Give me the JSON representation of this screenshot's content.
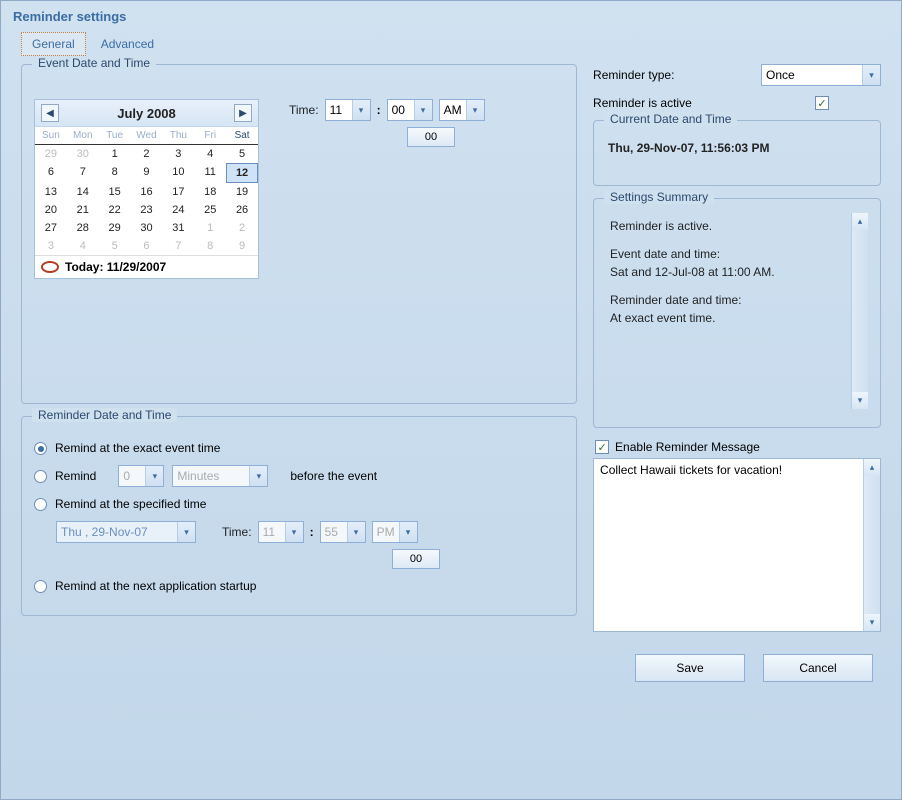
{
  "title": "Reminder settings",
  "tabs": {
    "general": "General",
    "advanced": "Advanced"
  },
  "event": {
    "legend": "Event Date and Time",
    "calendar": {
      "title": "July 2008",
      "day_heads": [
        "Sun",
        "Mon",
        "Tue",
        "Wed",
        "Thu",
        "Fri",
        "Sat"
      ],
      "today_label": "Today: 11/29/2007",
      "selected_day": 12
    },
    "time": {
      "label": "Time:",
      "hour": "11",
      "minute": "00",
      "ampm": "AM",
      "btn": "00"
    }
  },
  "reminder": {
    "legend": "Reminder Date and Time",
    "opt1": "Remind at the exact event time",
    "opt2_label": "Remind",
    "opt2_amount": "0",
    "opt2_unit": "Minutes",
    "opt2_suffix": "before the event",
    "opt3": "Remind at the specified time",
    "opt3_date": "Thu , 29-Nov-07",
    "opt3_time_label": "Time:",
    "opt3_hour": "11",
    "opt3_minute": "55",
    "opt3_ampm": "PM",
    "opt3_btn": "00",
    "opt4": "Remind at the next application startup"
  },
  "right": {
    "type_label": "Reminder type:",
    "type_value": "Once",
    "active_label": "Reminder is active",
    "current_legend": "Current Date and Time",
    "current_value": "Thu, 29-Nov-07, 11:56:03 PM",
    "summary_legend": "Settings Summary",
    "summary": {
      "line1": "Reminder is active.",
      "line2a": "Event date and time:",
      "line2b": "Sat and 12-Jul-08 at 11:00 AM.",
      "line3a": "Reminder date and time:",
      "line3b": "At exact event time."
    },
    "enable_msg_label": "Enable Reminder Message",
    "msg_text": "Collect Hawaii tickets for vacation!"
  },
  "buttons": {
    "save": "Save",
    "cancel": "Cancel"
  }
}
